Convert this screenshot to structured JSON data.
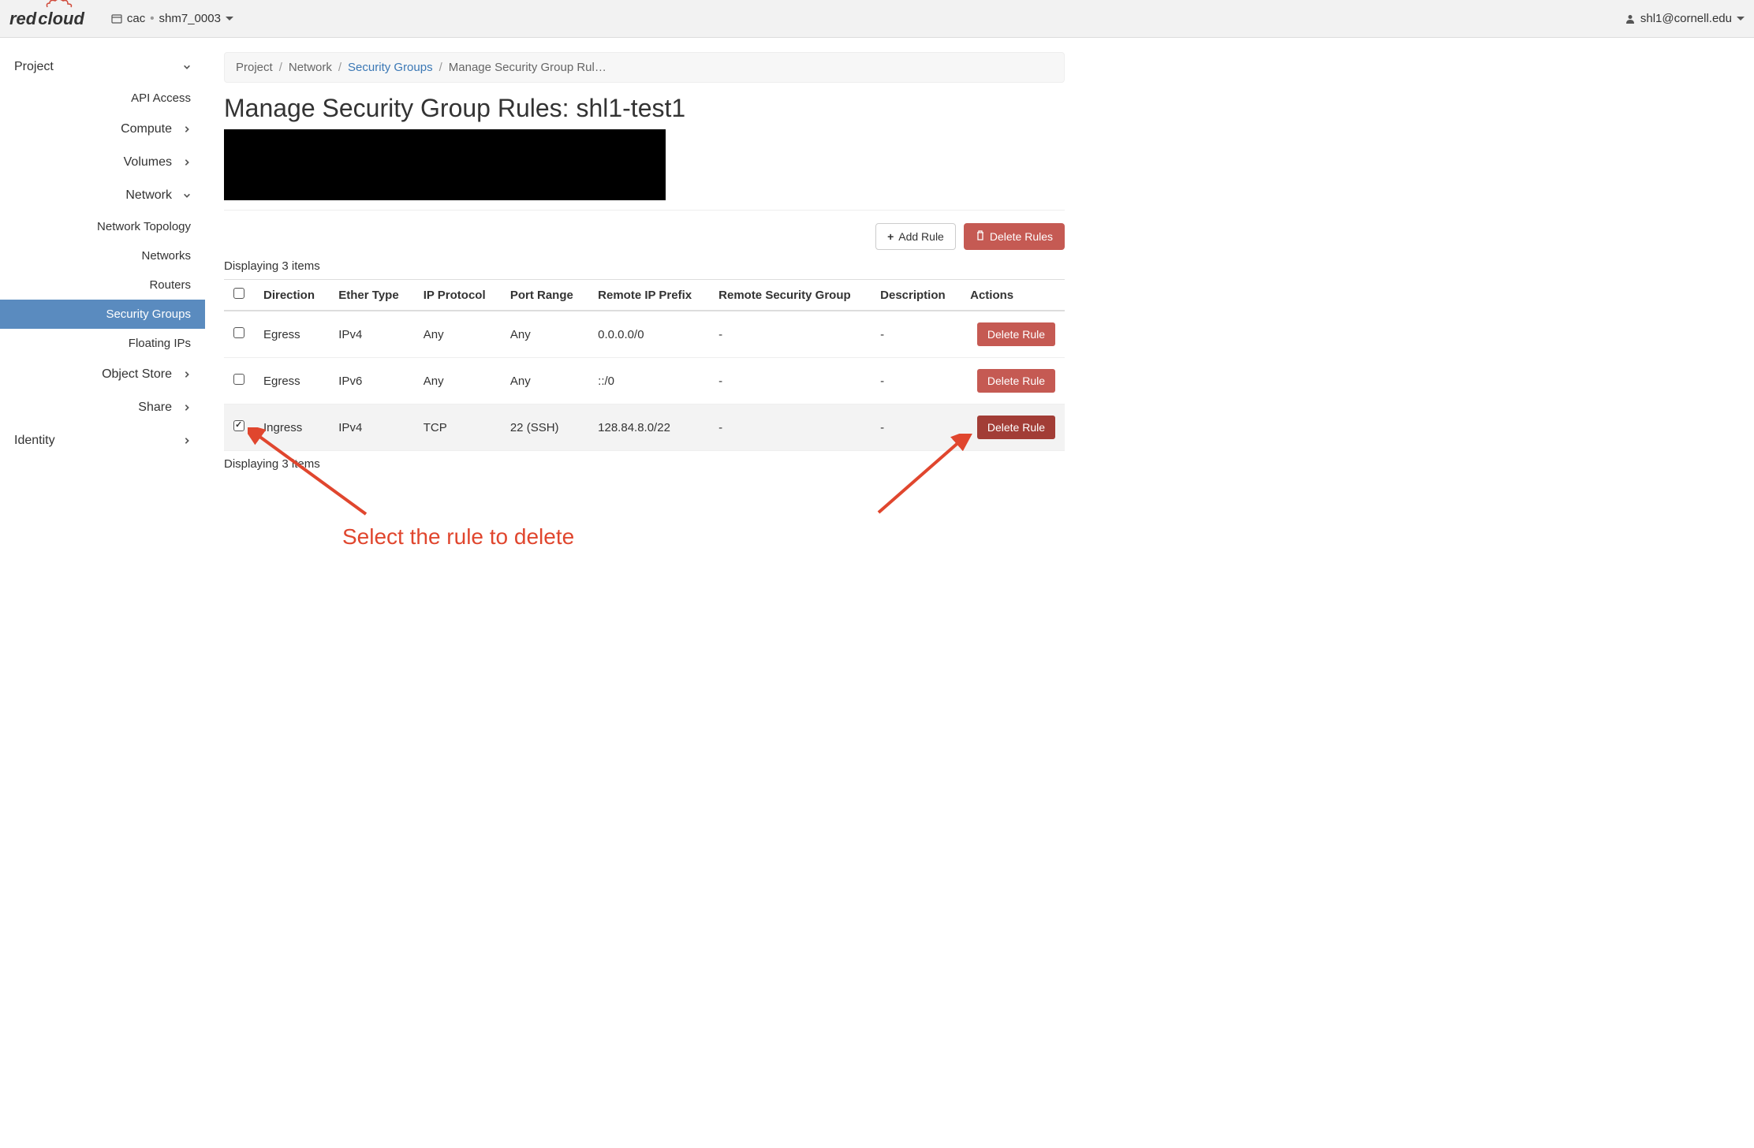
{
  "topbar": {
    "logo_text_1": "red",
    "logo_text_2": "cloud",
    "project_domain": "cac",
    "project_name": "shm7_0003",
    "user": "shl1@cornell.edu"
  },
  "sidebar": {
    "project_label": "Project",
    "api_access": "API Access",
    "compute": "Compute",
    "volumes": "Volumes",
    "network": "Network",
    "network_sub": {
      "topology": "Network Topology",
      "networks": "Networks",
      "routers": "Routers",
      "security_groups": "Security Groups",
      "floating_ips": "Floating IPs"
    },
    "object_store": "Object Store",
    "share": "Share",
    "identity": "Identity"
  },
  "breadcrumb": {
    "project": "Project",
    "network": "Network",
    "security_groups": "Security Groups",
    "current": "Manage Security Group Rul…"
  },
  "page": {
    "title": "Manage Security Group Rules: shl1-test1",
    "display_top": "Displaying 3 items",
    "display_bottom": "Displaying 3 items"
  },
  "buttons": {
    "add_rule": "Add Rule",
    "delete_rules": "Delete Rules",
    "delete_rule": "Delete Rule"
  },
  "table": {
    "headers": {
      "direction": "Direction",
      "ether_type": "Ether Type",
      "ip_protocol": "IP Protocol",
      "port_range": "Port Range",
      "remote_ip": "Remote IP Prefix",
      "remote_sg": "Remote Security Group",
      "description": "Description",
      "actions": "Actions"
    },
    "rows": [
      {
        "checked": false,
        "direction": "Egress",
        "ether": "IPv4",
        "proto": "Any",
        "port": "Any",
        "remote_ip": "0.0.0.0/0",
        "remote_sg": "-",
        "desc": "-",
        "delete_dark": false
      },
      {
        "checked": false,
        "direction": "Egress",
        "ether": "IPv6",
        "proto": "Any",
        "port": "Any",
        "remote_ip": "::/0",
        "remote_sg": "-",
        "desc": "-",
        "delete_dark": false
      },
      {
        "checked": true,
        "direction": "Ingress",
        "ether": "IPv4",
        "proto": "TCP",
        "port": "22 (SSH)",
        "remote_ip": "128.84.8.0/22",
        "remote_sg": "-",
        "desc": "-",
        "delete_dark": true
      }
    ]
  },
  "annotation": {
    "text": "Select the rule to delete"
  }
}
